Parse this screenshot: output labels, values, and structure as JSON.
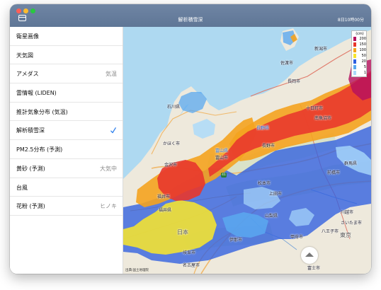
{
  "window": {
    "title": "解析積雪深",
    "time": "8日10時00分",
    "traffic_lights": [
      "#ff5f57",
      "#febc2e",
      "#28c840"
    ]
  },
  "sidebar": {
    "items": [
      {
        "label": "衛星画像",
        "detail": ""
      },
      {
        "label": "天気図",
        "detail": ""
      },
      {
        "label": "アメダス",
        "detail": "気温"
      },
      {
        "label": "雷情報 (LIDEN)",
        "detail": ""
      },
      {
        "label": "推計気象分布 (気温)",
        "detail": ""
      },
      {
        "label": "解析積雪深",
        "detail": "",
        "selected": true
      },
      {
        "label": "PM2.5分布 (予測)",
        "detail": ""
      },
      {
        "label": "黄砂 (予測)",
        "detail": "大気中"
      },
      {
        "label": "台風",
        "detail": ""
      },
      {
        "label": "花粉 (予測)",
        "detail": "ヒノキ"
      }
    ],
    "check_color": "#2f80ed"
  },
  "map": {
    "legend": {
      "unit": "(cm)",
      "levels": [
        {
          "value": "200",
          "color": "#b50f5f"
        },
        {
          "value": "150",
          "color": "#e8362c"
        },
        {
          "value": "100",
          "color": "#f4a31f"
        },
        {
          "value": "50",
          "color": "#f6e52f"
        },
        {
          "value": "20",
          "color": "#2f5fe0"
        },
        {
          "value": "5",
          "color": "#5aa8f0"
        },
        {
          "value": "1",
          "color": "#a9d9fb"
        }
      ]
    },
    "labels": {
      "niigata": "新潟市",
      "sado": "佐渡市",
      "nagaoka": "長岡市",
      "tokamachi": "十日町市",
      "minamiuonuma": "南魚沼市",
      "nagano_pref": "長野県",
      "nagano": "長野市",
      "toyama_pref": "富山県",
      "toyama": "富山市",
      "ishikawa": "石川県",
      "kahoku": "かほく市",
      "kanazawa": "金沢市",
      "fukui": "福井市",
      "fukui_pref": "福井県",
      "gunma": "群馬県",
      "maebashi": "前橋市",
      "matsumoto": "松本市",
      "ueda": "上田市",
      "kawagoe": "川越市",
      "saitama": "さいたま市",
      "hachioji": "八王子市",
      "tokyo": "東京",
      "yamanashi": "山梨県",
      "kofu": "甲府市",
      "ina": "伊那市",
      "fuji": "富士市",
      "gifu": "岐阜市",
      "nagoya": "名古屋市",
      "japan": "日本",
      "route": "41",
      "attribution": "出典:国土地理院"
    }
  }
}
